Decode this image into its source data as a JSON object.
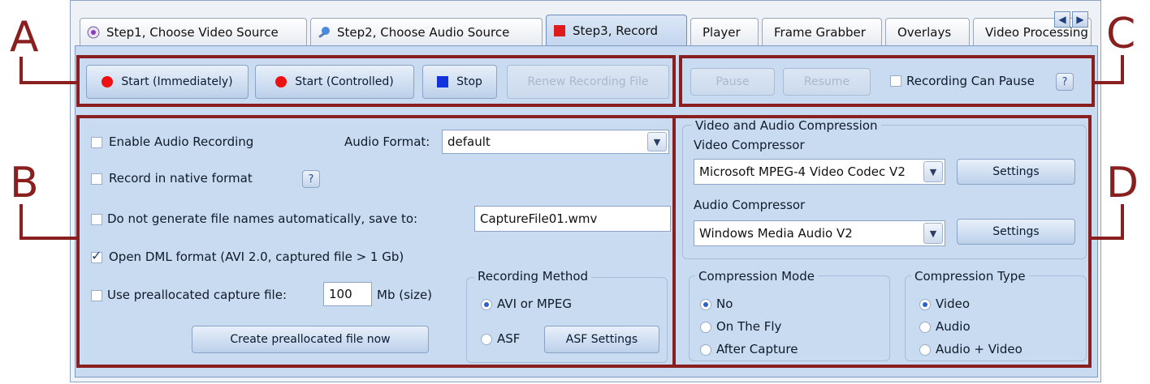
{
  "tabs": [
    {
      "label": "Step1, Choose Video Source",
      "icon": "video-source-icon"
    },
    {
      "label": "Step2, Choose Audio Source",
      "icon": "audio-source-icon"
    },
    {
      "label": "Step3, Record",
      "icon": "record-icon"
    },
    {
      "label": "Player"
    },
    {
      "label": "Frame Grabber"
    },
    {
      "label": "Overlays"
    },
    {
      "label": "Video Processing"
    }
  ],
  "annotations": {
    "a": "A",
    "b": "B",
    "c": "C",
    "d": "D"
  },
  "toolbar": {
    "start_immediately": "Start (Immediately)",
    "start_controlled": "Start (Controlled)",
    "stop": "Stop",
    "renew": "Renew Recording File",
    "pause": "Pause",
    "resume": "Resume",
    "can_pause": "Recording Can Pause",
    "help": "?"
  },
  "options": {
    "enable_audio": "Enable Audio Recording",
    "audio_format_label": "Audio Format:",
    "audio_format_value": "default",
    "native_format": "Record in native format",
    "no_auto_names": "Do not generate file names automatically, save to:",
    "file_name": "CaptureFile01.wmv",
    "open_dml": "Open DML format (AVI 2.0, captured file > 1 Gb)",
    "prealloc": "Use preallocated capture file:",
    "prealloc_size": "100",
    "prealloc_unit": "Mb (size)",
    "create_prealloc": "Create preallocated file now"
  },
  "recording_method": {
    "title": "Recording Method",
    "avi": "AVI or MPEG",
    "asf": "ASF",
    "asf_settings": "ASF Settings"
  },
  "compression": {
    "title": "Video and Audio Compression",
    "video_label": "Video Compressor",
    "video_value": "Microsoft MPEG-4 Video Codec V2",
    "audio_label": "Audio Compressor",
    "audio_value": "Windows Media Audio V2",
    "settings": "Settings",
    "mode_title": "Compression Mode",
    "mode_no": "No",
    "mode_fly": "On The Fly",
    "mode_after": "After Capture",
    "type_title": "Compression Type",
    "type_video": "Video",
    "type_audio": "Audio",
    "type_both": "Audio + Video"
  }
}
